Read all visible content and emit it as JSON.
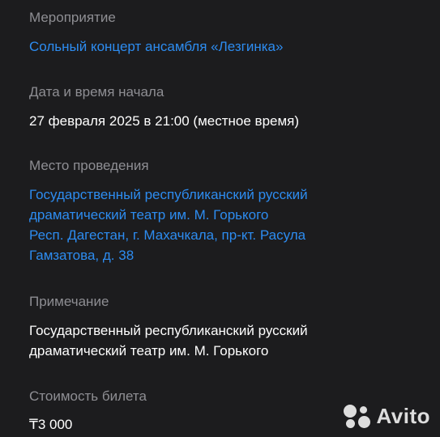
{
  "event": {
    "label": "Мероприятие",
    "title": "Сольный концерт ансамбля «Лезгинка»"
  },
  "datetime": {
    "label": "Дата и время начала",
    "value": "27 февраля 2025 в 21:00 (местное время)"
  },
  "venue": {
    "label": "Место проведения",
    "lines": [
      "Государственный республиканский русский",
      "драматический театр им. М. Горького",
      "Респ. Дагестан, г. Махачкала, пр-кт. Расула",
      "Гамзатова, д. 38"
    ]
  },
  "note": {
    "label": "Примечание",
    "lines": [
      "Государственный республиканский русский",
      "драматический театр им. М. Горького"
    ]
  },
  "price": {
    "label": "Стоимость билета",
    "value": "₸3 000"
  },
  "watermark": {
    "text": "Avito",
    "icon": "avito-logo-icon"
  },
  "colors": {
    "background": "#1c1c1e",
    "label": "#8e8e93",
    "text": "#ffffff",
    "link": "#2d8cf0"
  }
}
